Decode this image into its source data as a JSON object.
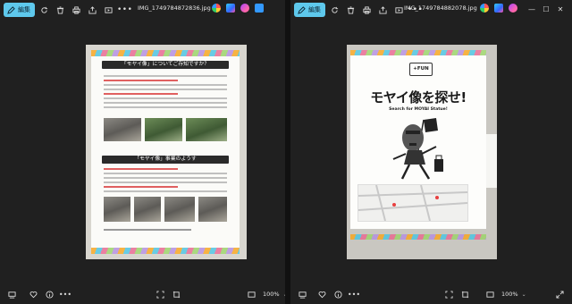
{
  "left_window": {
    "toolbar": {
      "edit_label": "編集",
      "more": "•••"
    },
    "filename": "IMG_1749784872836.jpg",
    "zoom": "100%",
    "poster": {
      "title": "「モヤイ像」についてご存知ですか？",
      "section2": "「モヤイ像」事業のようす"
    }
  },
  "right_window": {
    "toolbar": {
      "edit_label": "編集",
      "more": "•••"
    },
    "filename": "IMG_1749784882078.jpg",
    "zoom": "100%",
    "poster": {
      "logo": "+FUN",
      "title": "モヤイ像を探せ!",
      "subtitle": "Search for MOYAI Statue!"
    }
  },
  "window_controls": {
    "minimize": "—",
    "maximize": "☐",
    "close": "✕"
  },
  "icons": [
    "pencil-icon",
    "rotate-icon",
    "trash-icon",
    "print-icon",
    "share-icon",
    "slideshow-icon",
    "filmstrip-icon",
    "heart-icon",
    "info-icon",
    "fit-icon",
    "crop-icon",
    "fullscreen-icon"
  ]
}
